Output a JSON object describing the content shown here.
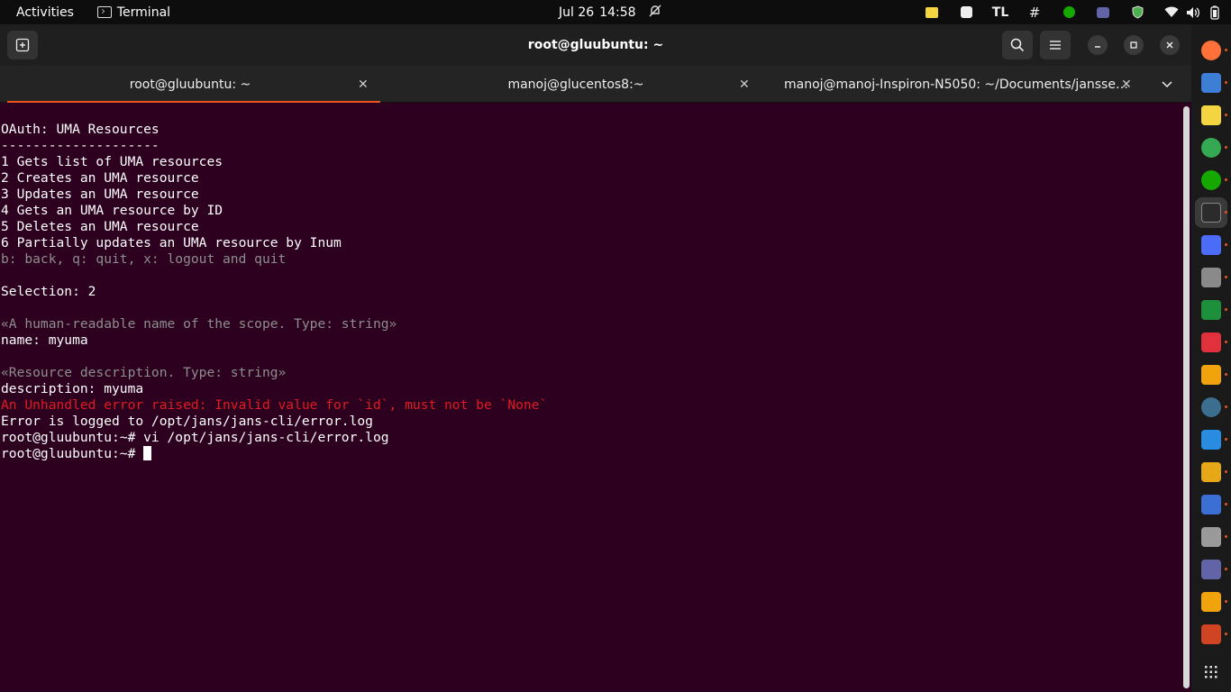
{
  "topbar": {
    "activities": "Activities",
    "app_name": "Terminal",
    "date": "Jul 26",
    "time": "14:58",
    "tray_tl": "TL"
  },
  "window": {
    "title": "root@gluubuntu: ~"
  },
  "tabs": [
    {
      "label": "root@gluubuntu: ~",
      "active": true
    },
    {
      "label": "manoj@glucentos8:~",
      "active": false
    },
    {
      "label": "manoj@manoj-Inspiron-N5050: ~/Documents/jansse…",
      "active": false
    }
  ],
  "terminal": {
    "lines": [
      {
        "text": "OAuth: UMA Resources",
        "style": "normal"
      },
      {
        "text": "--------------------",
        "style": "normal"
      },
      {
        "text": "1 Gets list of UMA resources",
        "style": "normal"
      },
      {
        "text": "2 Creates an UMA resource",
        "style": "normal"
      },
      {
        "text": "3 Updates an UMA resource",
        "style": "normal"
      },
      {
        "text": "4 Gets an UMA resource by ID",
        "style": "normal"
      },
      {
        "text": "5 Deletes an UMA resource",
        "style": "normal"
      },
      {
        "text": "6 Partially updates an UMA resource by Inum",
        "style": "normal"
      },
      {
        "text": "b: back, q: quit, x: logout and quit",
        "style": "dim"
      },
      {
        "text": "",
        "style": "normal"
      },
      {
        "text": "Selection: 2",
        "style": "normal"
      },
      {
        "text": "",
        "style": "normal"
      },
      {
        "text": "«A human-readable name of the scope. Type: string»",
        "style": "dim"
      },
      {
        "text": "name: myuma",
        "style": "normal"
      },
      {
        "text": "",
        "style": "normal"
      },
      {
        "text": "«Resource description. Type: string»",
        "style": "dim"
      },
      {
        "text": "description: myuma",
        "style": "normal"
      },
      {
        "text": "An Unhandled error raised: Invalid value for `id`, must not be `None`",
        "style": "err"
      },
      {
        "text": "Error is logged to /opt/jans/jans-cli/error.log",
        "style": "normal"
      },
      {
        "text": "root@gluubuntu:~# vi /opt/jans/jans-cli/error.log",
        "style": "normal"
      }
    ],
    "prompt": "root@gluubuntu:~# "
  },
  "dock": {
    "icons": [
      {
        "name": "firefox-icon",
        "color": "#ff7139"
      },
      {
        "name": "document-viewer-icon",
        "color": "#3d7fd6"
      },
      {
        "name": "sticky-notes-icon",
        "color": "#f5d442"
      },
      {
        "name": "chrome-icon",
        "color": "#34a853"
      },
      {
        "name": "upwork-icon",
        "color": "#14a800"
      },
      {
        "name": "terminal-icon",
        "color": "#2b2b2b"
      },
      {
        "name": "screenshot-icon",
        "color": "#4a6cf7"
      },
      {
        "name": "files-icon",
        "color": "#8a8a8a"
      },
      {
        "name": "spreadsheet-icon",
        "color": "#1e8f3a"
      },
      {
        "name": "screen-recorder-icon",
        "color": "#e0313c"
      },
      {
        "name": "remote-desktop-icon",
        "color": "#f0a30a"
      },
      {
        "name": "web-browser-icon",
        "color": "#3c6e8f"
      },
      {
        "name": "vscode-icon",
        "color": "#2a8ce0"
      },
      {
        "name": "archive-icon",
        "color": "#e6a817"
      },
      {
        "name": "text-editor-icon",
        "color": "#3b6fd4"
      },
      {
        "name": "settings-icon",
        "color": "#9a9a9a"
      },
      {
        "name": "teams-icon",
        "color": "#6264a7"
      },
      {
        "name": "remote-desktop-2-icon",
        "color": "#f0a30a"
      },
      {
        "name": "presentation-icon",
        "color": "#d04423"
      }
    ]
  }
}
